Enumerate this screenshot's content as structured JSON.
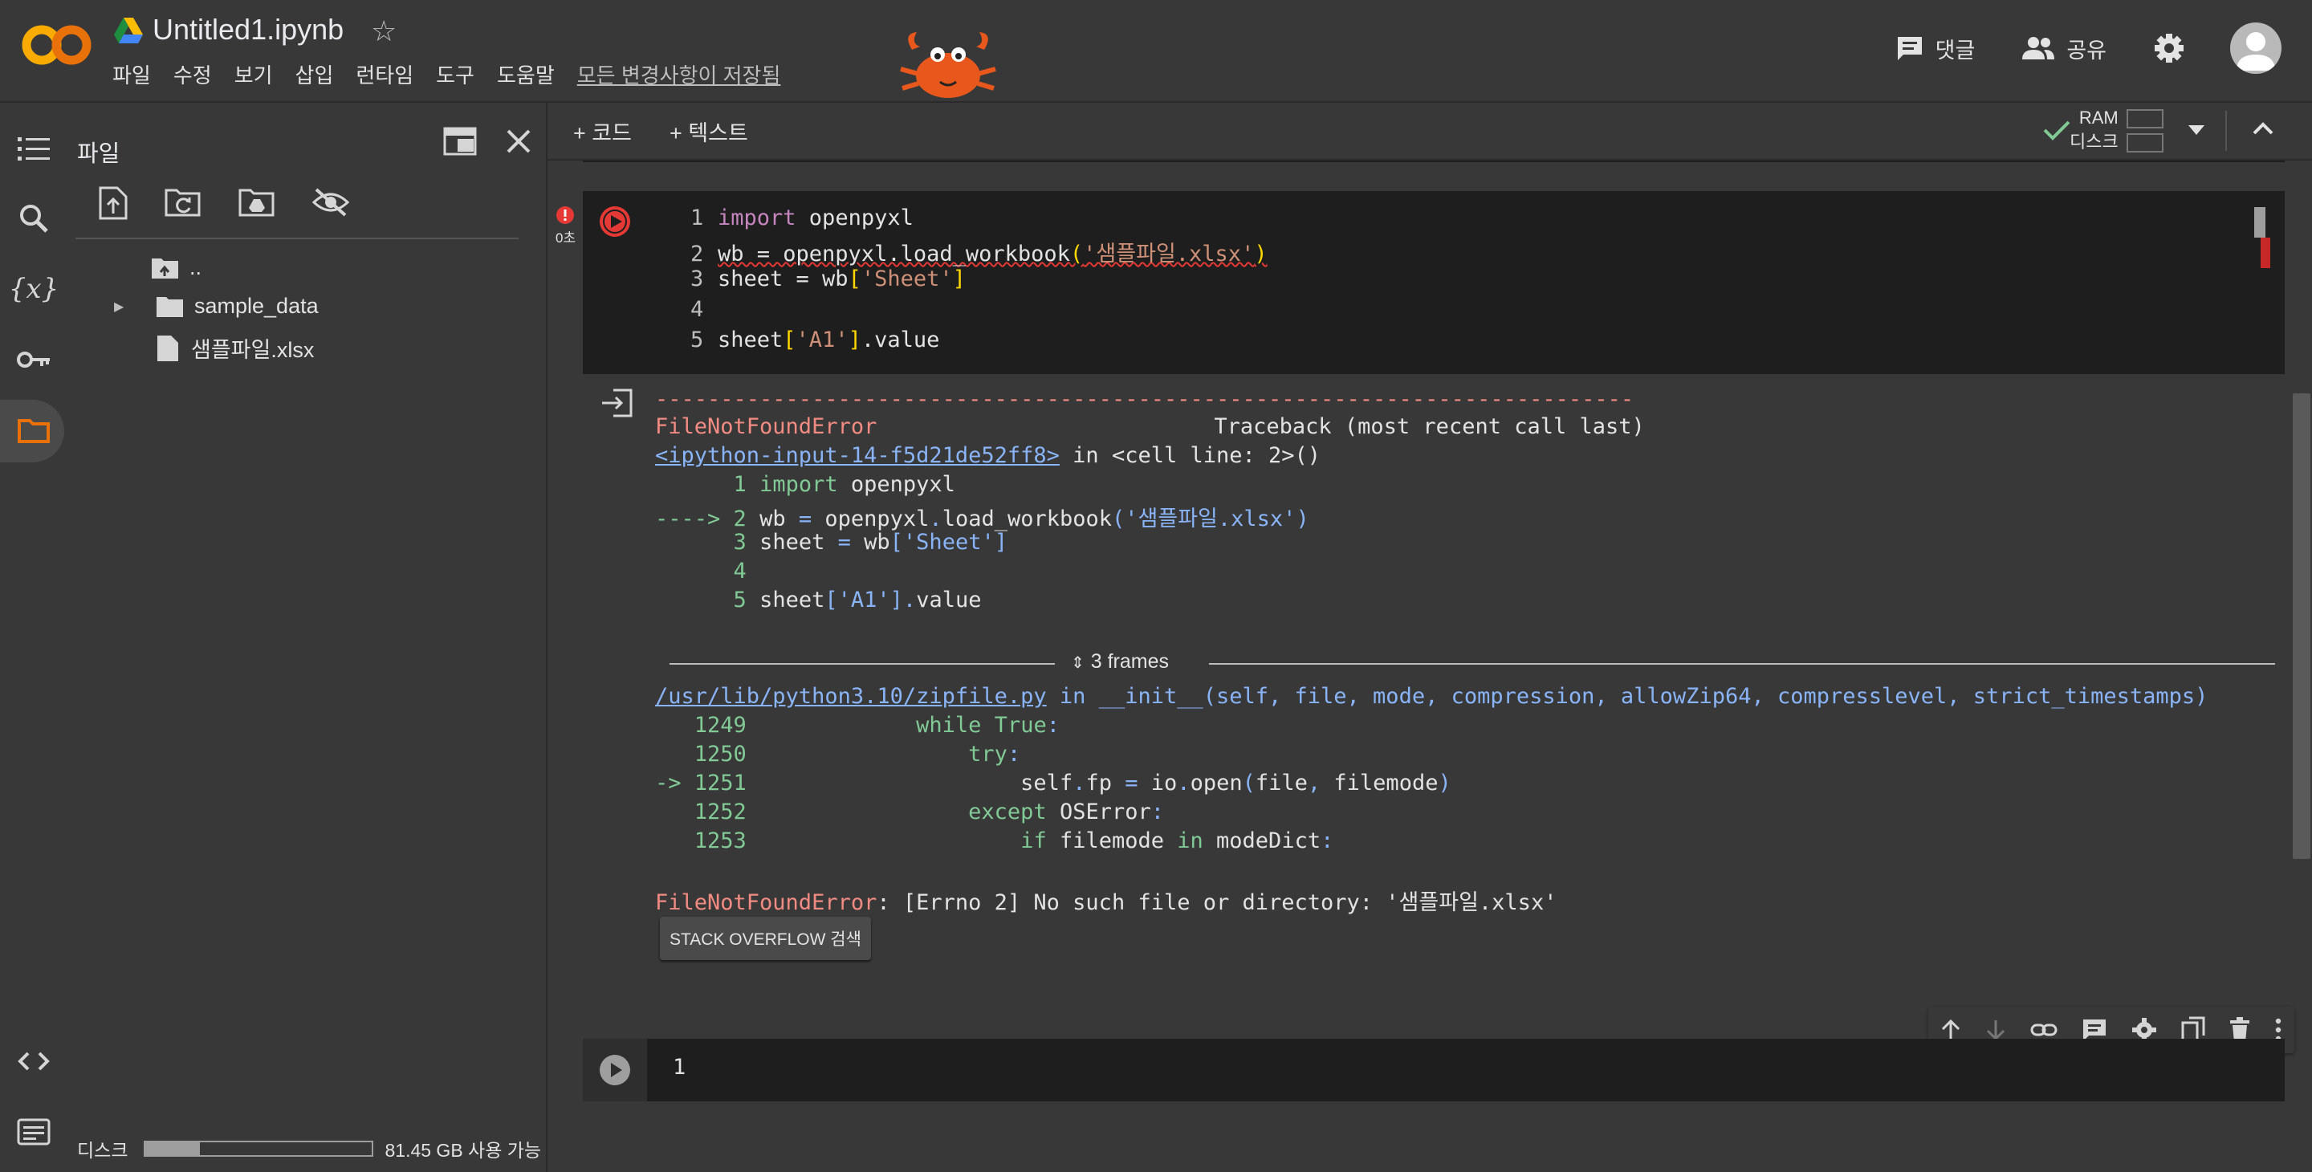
{
  "header": {
    "title": "Untitled1.ipynb",
    "menus": [
      "파일",
      "수정",
      "보기",
      "삽입",
      "런타임",
      "도구",
      "도움말"
    ],
    "saved_status": "모든 변경사항이 저장됨",
    "comment_label": "댓글",
    "share_label": "공유"
  },
  "files_panel": {
    "title": "파일",
    "tree": [
      {
        "name": "..",
        "type": "parent"
      },
      {
        "name": "sample_data",
        "type": "folder"
      },
      {
        "name": "샘플파일.xlsx",
        "type": "file"
      }
    ],
    "disk_label": "디스크",
    "disk_free": "81.45 GB 사용 가능",
    "disk_used_fraction": 0.24
  },
  "notebook_toolbar": {
    "add_code": "+ 코드",
    "add_text": "+ 텍스트",
    "ram_label": "RAM",
    "disk_label": "디스크"
  },
  "cell": {
    "exec_time": "0초",
    "lines": [
      "1",
      "2",
      "3",
      "4",
      "5"
    ]
  },
  "output": {
    "dashes": "---------------------------------------------------------------------------",
    "error_name": "FileNotFoundError",
    "traceback_label": "Traceback (most recent call last)",
    "input_link": "<ipython-input-14-f5d21de52ff8>",
    "in_cell": " in <cell line: 2>()",
    "arrow": "----> ",
    "frames_label": "3 frames",
    "zip_link": "/usr/lib/python3.10/zipfile.py",
    "zip_in": " in __init__(self, file, mode, compression, allowZip64, compresslevel, strict_timestamps)",
    "zip_lines": [
      "1249",
      "1250",
      "1251",
      "1252",
      "1253"
    ],
    "final_error": "FileNotFoundError",
    "final_msg": ": [Errno 2] No such file or directory: '샘플파일.xlsx'",
    "so_button": "STACK OVERFLOW 검색"
  },
  "empty_cell": {
    "line": "1"
  },
  "colors": {
    "background": "#383838",
    "cell_bg": "#1e1e1e",
    "error_red": "#f28b82",
    "green": "#81c995",
    "blue": "#8ab4f8",
    "run_button_red": "#e53935"
  }
}
